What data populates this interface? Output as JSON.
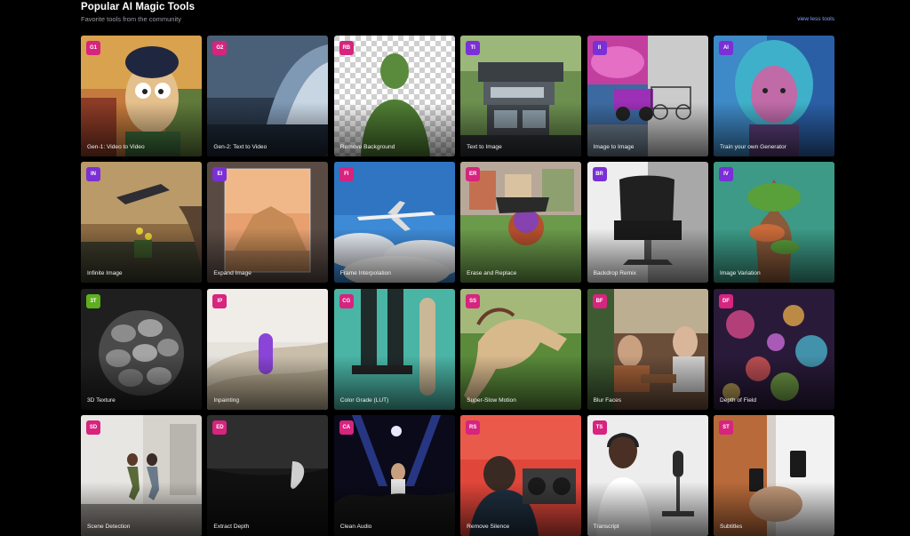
{
  "header": {
    "title": "Popular AI Magic Tools",
    "subtitle": "Favorite tools from the community",
    "view_less": "view less tools"
  },
  "colors": {
    "badge_magenta": "#d6247f",
    "badge_purple": "#7b2fd6",
    "badge_green": "#5fae1e",
    "link": "#7fa3ff"
  },
  "tools": [
    {
      "badge": "G1",
      "label": "Gen-1: Video to Video",
      "badge_color": "#d6247f",
      "icon": "animated-character-image"
    },
    {
      "badge": "G2",
      "label": "Gen-2: Text to Video",
      "badge_color": "#d6247f",
      "icon": "ocean-wave-image"
    },
    {
      "badge": "RB",
      "label": "Remove Background",
      "badge_color": "#d6247f",
      "icon": "person-cutout-image"
    },
    {
      "badge": "TI",
      "label": "Text to Image",
      "badge_color": "#7b2fd6",
      "icon": "modern-house-image"
    },
    {
      "badge": "II",
      "label": "Image to Image",
      "badge_color": "#7b2fd6",
      "icon": "jeep-sketch-image"
    },
    {
      "badge": "AI",
      "label": "Train your own Generator",
      "badge_color": "#7b2fd6",
      "icon": "neon-portrait-image"
    },
    {
      "badge": "IN",
      "label": "Infinite Image",
      "badge_color": "#7b2fd6",
      "icon": "surreal-landscape-image"
    },
    {
      "badge": "EI",
      "label": "Expand Image",
      "badge_color": "#7b2fd6",
      "icon": "desert-rock-image"
    },
    {
      "badge": "FI",
      "label": "Frame Interpolation",
      "badge_color": "#d6247f",
      "icon": "airplane-sky-image"
    },
    {
      "badge": "ER",
      "label": "Erase and Replace",
      "badge_color": "#d6247f",
      "icon": "soccer-ball-image"
    },
    {
      "badge": "BR",
      "label": "Backdrop Remix",
      "badge_color": "#7b2fd6",
      "icon": "lounge-chair-image"
    },
    {
      "badge": "IV",
      "label": "Image Variation",
      "badge_color": "#7b2fd6",
      "icon": "fantasy-tree-image"
    },
    {
      "badge": "3T",
      "label": "3D Texture",
      "badge_color": "#5fae1e",
      "icon": "stone-sphere-image"
    },
    {
      "badge": "IP",
      "label": "Inpainting",
      "badge_color": "#d6247f",
      "icon": "purple-object-dunes-image"
    },
    {
      "badge": "CG",
      "label": "Color Grade (LUT)",
      "badge_color": "#d6247f",
      "icon": "skateboard-image"
    },
    {
      "badge": "SS",
      "label": "Super-Slow Motion",
      "badge_color": "#d6247f",
      "icon": "horse-image"
    },
    {
      "badge": "BF",
      "label": "Blur Faces",
      "badge_color": "#d6247f",
      "icon": "cafe-people-image"
    },
    {
      "badge": "DF",
      "label": "Depth of Field",
      "badge_color": "#d6247f",
      "icon": "bokeh-lights-image"
    },
    {
      "badge": "SD",
      "label": "Scene Detection",
      "badge_color": "#d6247f",
      "icon": "running-people-image"
    },
    {
      "badge": "ED",
      "label": "Extract Depth",
      "badge_color": "#d6247f",
      "icon": "depth-map-image"
    },
    {
      "badge": "CA",
      "label": "Clean Audio",
      "badge_color": "#d6247f",
      "icon": "concert-crowd-image"
    },
    {
      "badge": "RS",
      "label": "Remove Silence",
      "badge_color": "#d6247f",
      "icon": "boombox-image"
    },
    {
      "badge": "TS",
      "label": "Transcript",
      "badge_color": "#d6247f",
      "icon": "podcast-microphone-image"
    },
    {
      "badge": "ST",
      "label": "Subtitles",
      "badge_color": "#d6247f",
      "icon": "phones-people-image"
    }
  ]
}
